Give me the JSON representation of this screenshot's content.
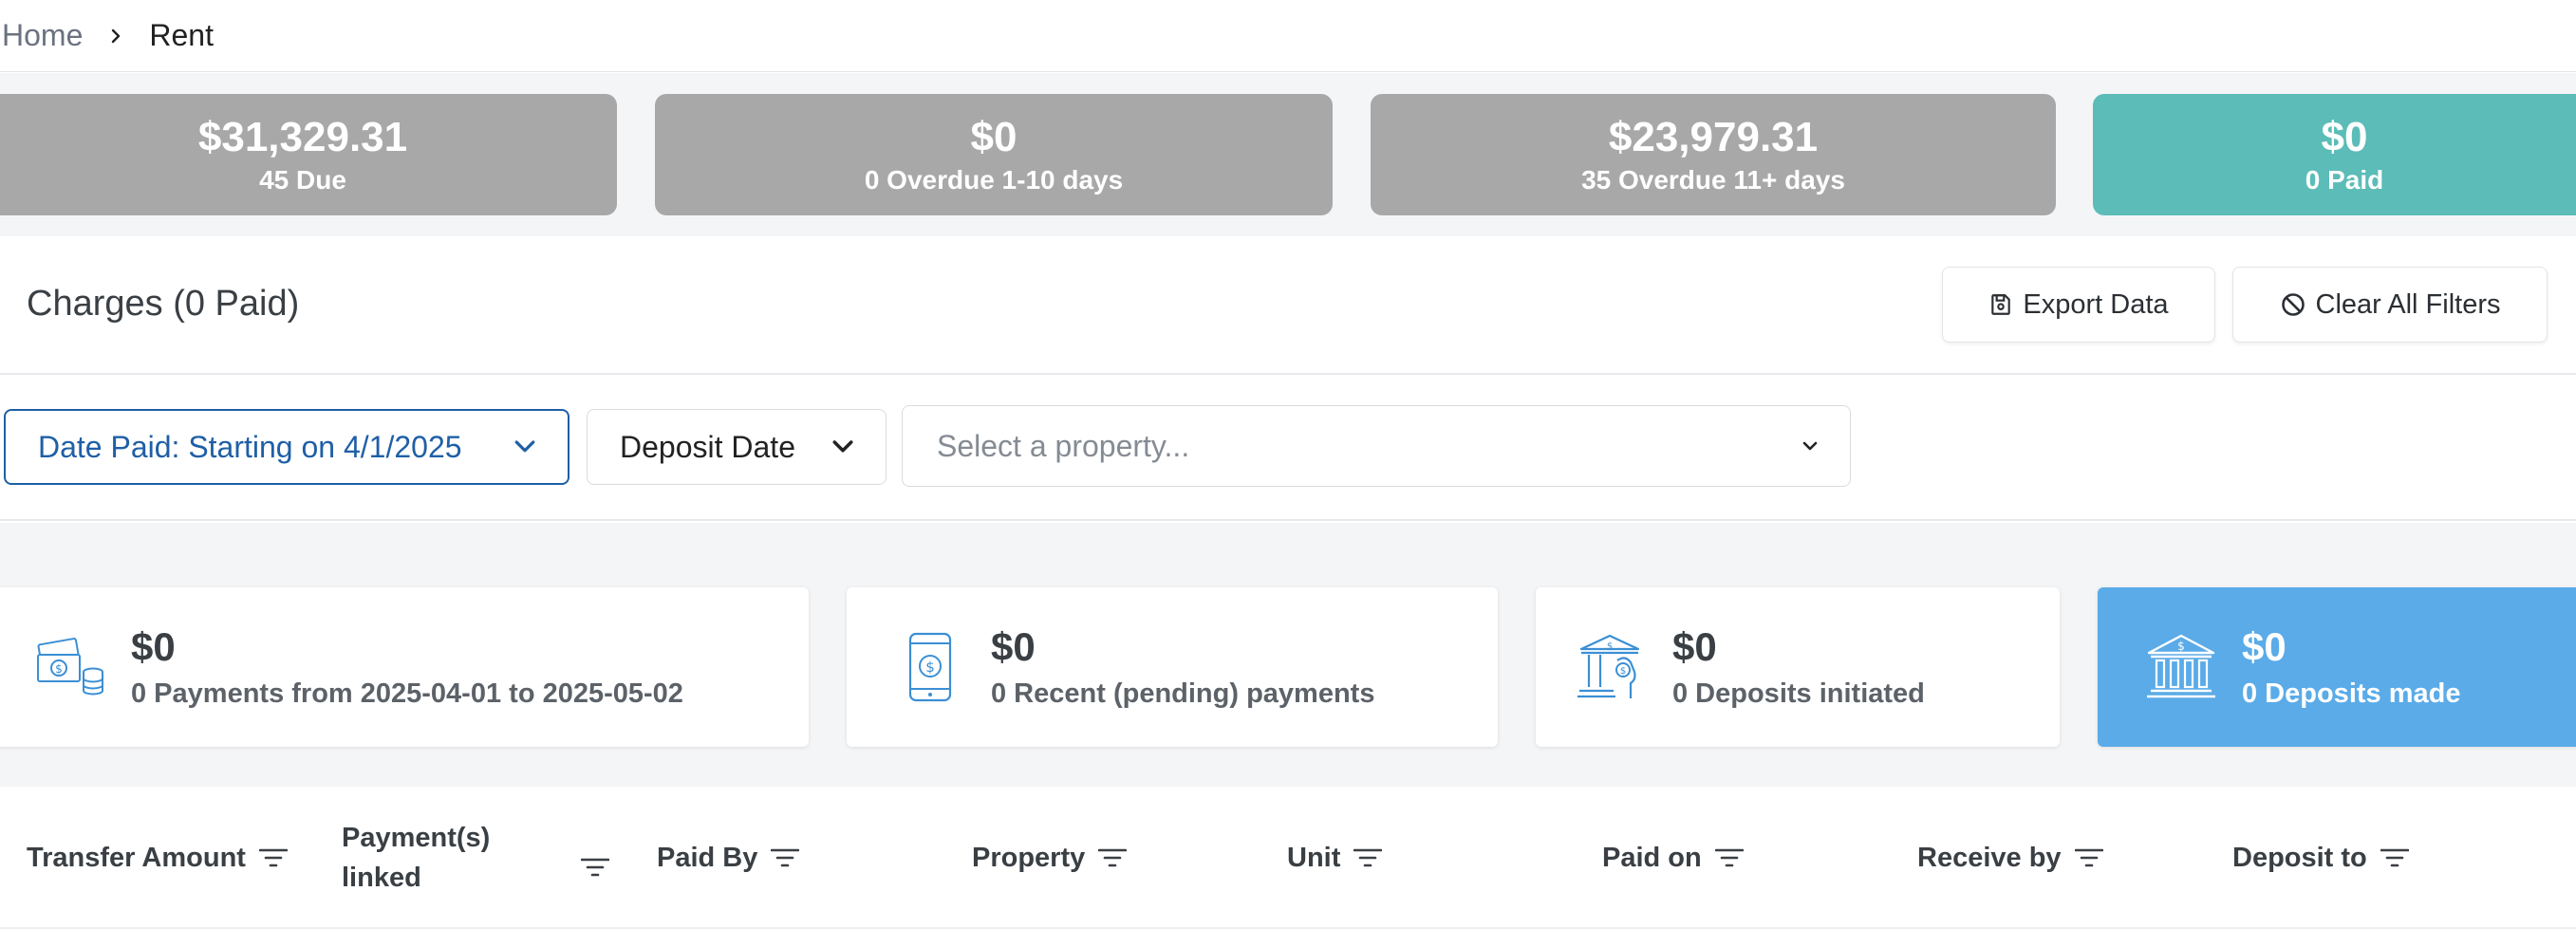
{
  "breadcrumb": {
    "home": "Home",
    "current": "Rent"
  },
  "summary_cards": [
    {
      "amount": "$31,329.31",
      "label": "45 Due"
    },
    {
      "amount": "$0",
      "label": "0 Overdue 1-10 days"
    },
    {
      "amount": "$23,979.31",
      "label": "35 Overdue 11+ days"
    },
    {
      "amount": "$0",
      "label": "0 Paid"
    }
  ],
  "colors": {
    "summary_inactive": "#a8a8a8",
    "summary_active": "#5bbcb8",
    "accent_blue": "#1f5fa6",
    "stats_active": "#5aabe8"
  },
  "charges": {
    "title": "Charges (0 Paid)",
    "export_label": "Export Data",
    "clear_label": "Clear All Filters"
  },
  "filters": {
    "date_paid": "Date Paid: Starting on 4/1/2025",
    "deposit_date": "Deposit Date",
    "property_placeholder": "Select a property..."
  },
  "stats": [
    {
      "icon": "cash-icon",
      "amount": "$0",
      "label": "0 Payments from 2025-04-01 to 2025-05-02"
    },
    {
      "icon": "mobile-payment-icon",
      "amount": "$0",
      "label": "0 Recent (pending) payments"
    },
    {
      "icon": "bank-transfer-icon",
      "amount": "$0",
      "label": "0 Deposits initiated"
    },
    {
      "icon": "bank-icon",
      "amount": "$0",
      "label": "0 Deposits made"
    }
  ],
  "table_columns": [
    "Transfer Amount",
    "Payment(s) linked",
    "Paid By",
    "Property",
    "Unit",
    "Paid on",
    "Receive by",
    "Deposit to"
  ]
}
